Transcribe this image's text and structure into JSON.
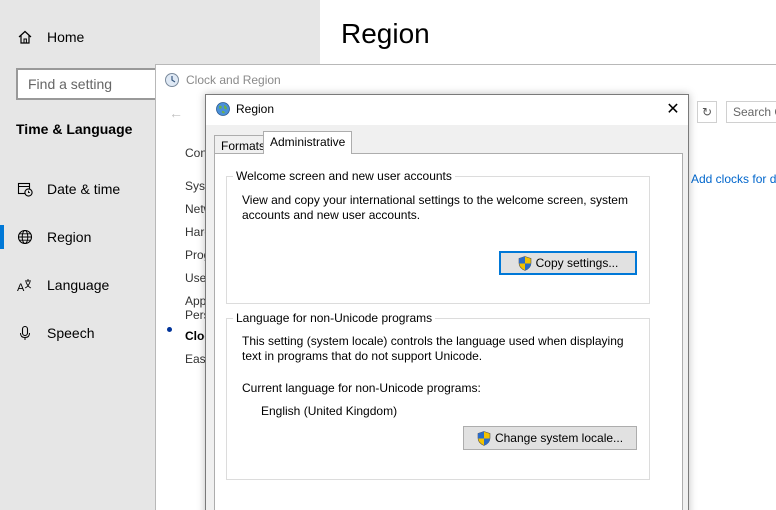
{
  "settings": {
    "title": "Region",
    "search_placeholder": "Find a setting",
    "home_label": "Home",
    "section_heading": "Time & Language",
    "nav": [
      {
        "label": "Date & time",
        "icon": "calendar-clock-icon"
      },
      {
        "label": "Region",
        "icon": "globe-icon",
        "selected": true
      },
      {
        "label": "Language",
        "icon": "language-icon"
      },
      {
        "label": "Speech",
        "icon": "microphone-icon"
      }
    ],
    "accent_color": "#0078d7"
  },
  "clock_region_window": {
    "title": "Clock and Region",
    "search_text": "Search C",
    "sidebar": [
      "Con",
      "Syst",
      "Netw",
      "Hard",
      "Prog",
      "User",
      "App",
      "Pers",
      "Clock",
      "Ease"
    ],
    "add_clocks_link": "Add clocks for d"
  },
  "region_dialog": {
    "title": "Region",
    "tabs": [
      "Formats",
      "Administrative"
    ],
    "active_tab": "Administrative",
    "welcome_group": {
      "legend": "Welcome screen and new user accounts",
      "description_line1": "View and copy your international settings to the welcome screen, system",
      "description_line2": "accounts and new user accounts.",
      "button_label": "Copy settings..."
    },
    "unicode_group": {
      "legend": "Language for non-Unicode programs",
      "description_line1": "This setting (system locale) controls the language used when displaying",
      "description_line2": "text in programs that do not support Unicode.",
      "current_label": "Current language for non-Unicode programs:",
      "current_value": "English (United Kingdom)",
      "button_label": "Change system locale..."
    }
  }
}
